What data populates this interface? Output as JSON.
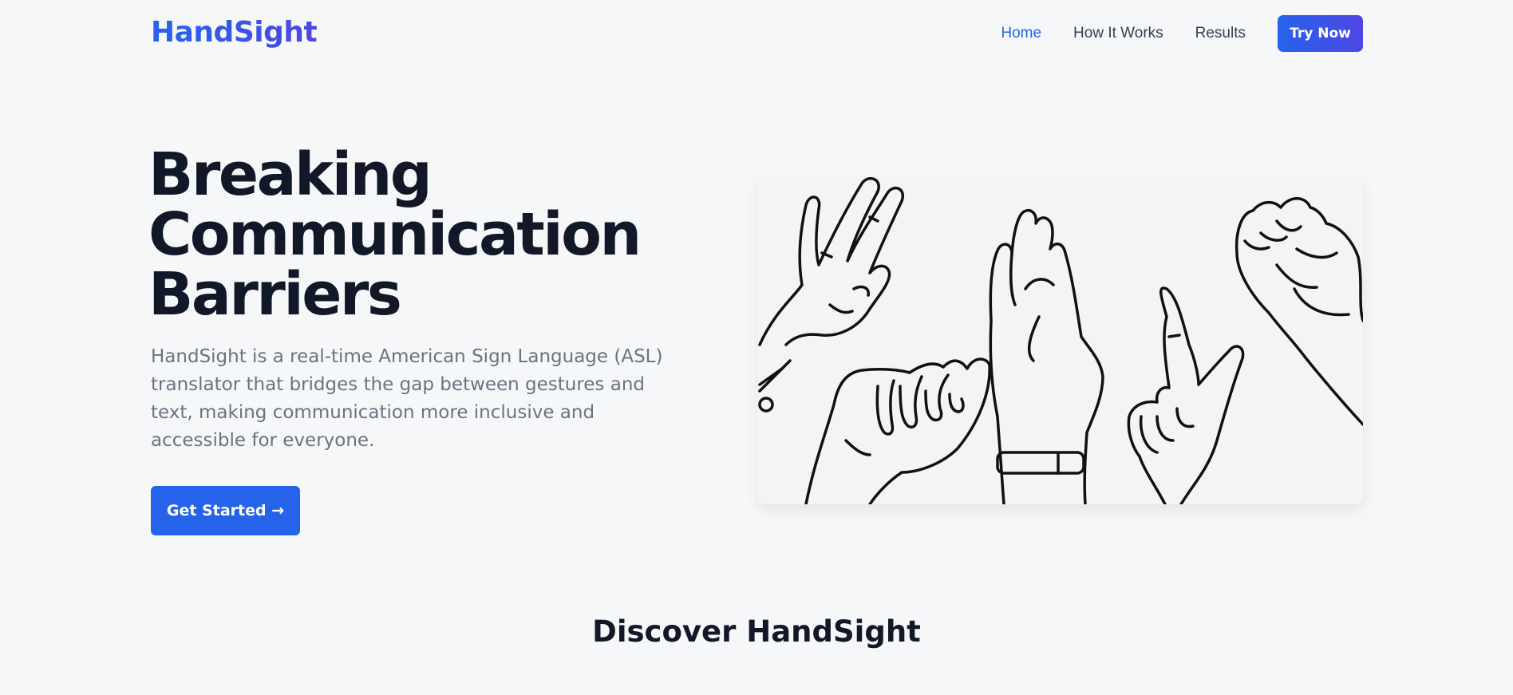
{
  "brand": {
    "name": "HandSight"
  },
  "nav": {
    "links": [
      {
        "label": "Home",
        "active": true
      },
      {
        "label": "How It Works",
        "active": false
      },
      {
        "label": "Results",
        "active": false
      }
    ],
    "cta_label": "Try Now"
  },
  "hero": {
    "title_lines": [
      "Breaking",
      "Communication",
      "Barriers"
    ],
    "description": "HandSight is a real-time American Sign Language (ASL) translator that bridges the gap between gestures and text, making communication more inclusive and accessible for everyone.",
    "button_label": "Get Started →",
    "illustration": "asl-hand-signs-illustration"
  },
  "discover": {
    "title": "Discover HandSight"
  },
  "colors": {
    "primary": "#2563eb",
    "gradient_end": "#4f46e5",
    "heading": "#111827",
    "body_text": "#6b7280",
    "background": "#f6f7f9"
  }
}
